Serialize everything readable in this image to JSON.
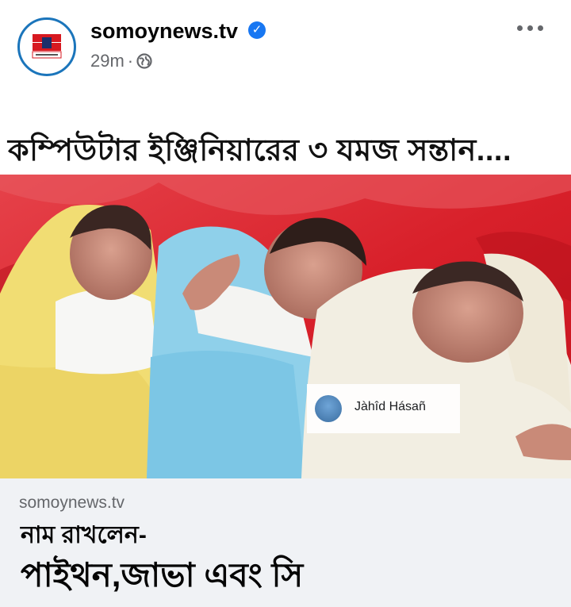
{
  "post": {
    "page_name": "somoynews.tv",
    "verified_icon": "verified-check-icon",
    "time_ago": "29m",
    "separator": "·",
    "privacy_icon": "globe-icon",
    "more_icon": "more-options-icon",
    "avatar_logo_text": "সময় সংবাদ"
  },
  "headline": {
    "text": "কম্পিউটার ইঞ্জিনিয়ারের ৩ যমজ সন্তান...."
  },
  "photo": {
    "watermark_name": "Jàhîd Hásañ",
    "colors": {
      "background_red": "#d9202b",
      "blanket_yellow": "#f4e27a",
      "blanket_blue": "#8fd0ea",
      "blanket_cream": "#f2eee2"
    }
  },
  "link_preview": {
    "domain": "somoynews.tv",
    "line1": "নাম রাখলেন-",
    "line2": "পাইথন,জাভা এবং সি"
  },
  "colors": {
    "accent_blue": "#1877f2",
    "avatar_ring": "#1b75bb",
    "secondary_text": "#65676b"
  }
}
